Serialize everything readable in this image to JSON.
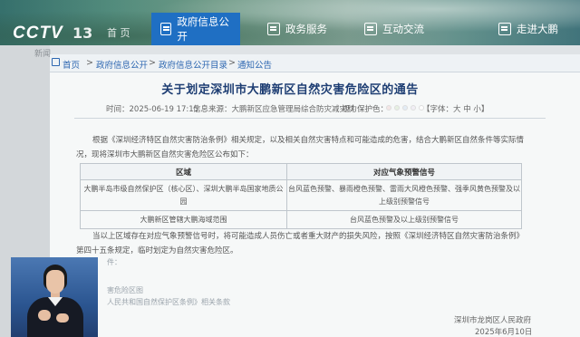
{
  "header": {
    "logo": "CCTV",
    "channel": "13",
    "nav_home": "首 页",
    "tabs": [
      {
        "label": "政府信息公开",
        "active": true
      },
      {
        "label": "政务服务",
        "active": false
      },
      {
        "label": "互动交流",
        "active": false
      },
      {
        "label": "走进大鹏",
        "active": false
      }
    ]
  },
  "left_text": "新闻",
  "breadcrumb": [
    "首页",
    "政府信息公开",
    "政府信息公开目录",
    "通知公告"
  ],
  "breadcrumb_sep": ">",
  "doc": {
    "title": "关于划定深圳市大鹏新区自然灾害危险区的通告",
    "time": "时间：2025-06-19 17:15",
    "source": "信息来源：大鹏新区应急管理局综合防灾减灾科",
    "vision": "视力保护色：",
    "font_size": "【字体：大 中 小】",
    "vision_colors": [
      "#f4e6e6",
      "#e6f0e2",
      "#e3ecf5",
      "#f1eef5",
      "#ffffff"
    ],
    "para1": "根据《深圳经济特区自然灾害防治条例》相关规定，以及相关自然灾害特点和可能造成的危害，结合大鹏新区自然条件等实际情况，现将深圳市大鹏新区自然灾害危险区公布如下：",
    "table": {
      "headers": [
        "区域",
        "对应气象预警信号"
      ],
      "rows": [
        [
          "大鹏半岛市级自然保护区（核心区）、深圳大鹏半岛国家地质公园",
          "台风蓝色预警、暴雨橙色预警、雷雨大风橙色预警、强季风黄色预警及以上级别预警信号"
        ],
        [
          "大鹏新区管辖大鹏海域范围",
          "台风蓝色预警及以上级别预警信号"
        ]
      ]
    },
    "para2": "当以上区域存在对应气象预警信号时，将可能造成人员伤亡或者重大财产的损失风险，按照《深圳经济特区自然灾害防治条例》第四十五条规定，临时划定为自然灾害危险区。",
    "attach_label": "件：",
    "attach1": "害危险区图",
    "attach2": "人民共和国自然保护区条例》相关条款",
    "signature": "深圳市龙岗区人民政府",
    "date": "2025年6月10日"
  }
}
